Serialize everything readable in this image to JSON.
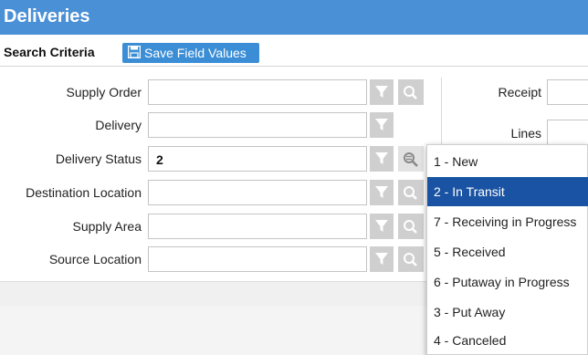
{
  "header": {
    "title": "Deliveries"
  },
  "criteria": {
    "label": "Search Criteria",
    "save_button": "Save Field Values"
  },
  "fields": [
    {
      "label": "Supply Order",
      "value": ""
    },
    {
      "label": "Delivery",
      "value": ""
    },
    {
      "label": "Delivery Status",
      "value": "2"
    },
    {
      "label": "Destination Location",
      "value": ""
    },
    {
      "label": "Supply Area",
      "value": ""
    },
    {
      "label": "Source Location",
      "value": ""
    }
  ],
  "right_fields": [
    {
      "label": "Receipt"
    },
    {
      "label": "Lines"
    }
  ],
  "status_options": [
    "1 - New",
    "2 - In Transit",
    "7 - Receiving in Progress",
    "5 - Received",
    "6 - Putaway in Progress",
    "3 - Put Away",
    "4 - Canceled"
  ],
  "selected_option": "2 - In Transit",
  "colors": {
    "header": "#4a90d6",
    "selected": "#1a53a3",
    "save_button": "#3b8ed6"
  }
}
